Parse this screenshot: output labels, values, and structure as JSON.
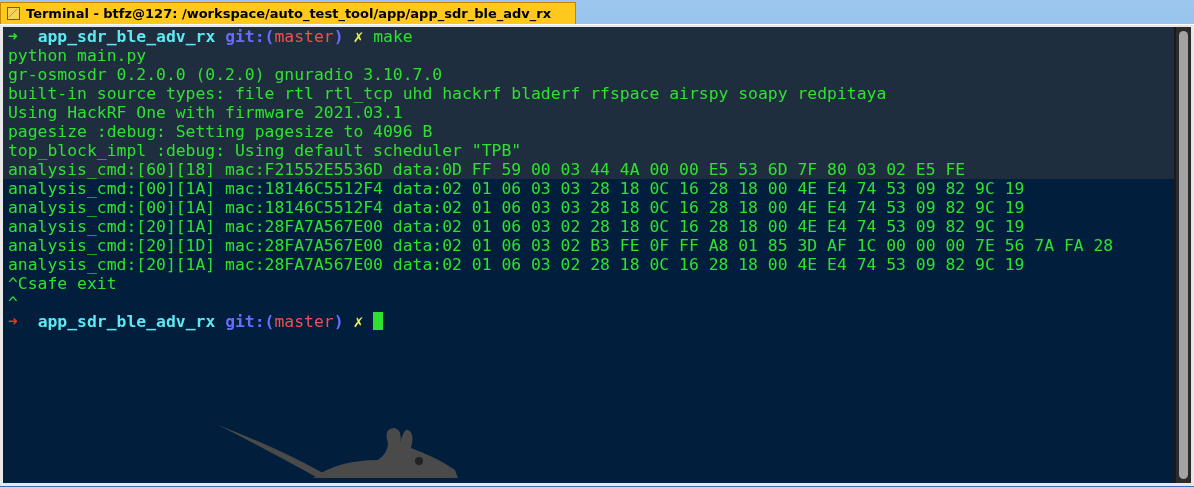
{
  "window": {
    "title": "Terminal - btfz@127: /workspace/auto_test_tool/app/app_sdr_ble_adv_rx"
  },
  "lines": [
    {
      "kind": "prompt",
      "failed": false,
      "arrow": "➜",
      "directory": "app_sdr_ble_adv_rx",
      "git_open": "git:(",
      "branch": "master",
      "git_close": ")",
      "dirty": "✗",
      "command": "make",
      "cursor": false
    },
    {
      "kind": "output",
      "text": "python main.py"
    },
    {
      "kind": "output",
      "text": "gr-osmosdr 0.2.0.0 (0.2.0) gnuradio 3.10.7.0"
    },
    {
      "kind": "output",
      "text": "built-in source types: file rtl rtl_tcp uhd hackrf bladerf rfspace airspy soapy redpitaya"
    },
    {
      "kind": "output",
      "text": "Using HackRF One with firmware 2021.03.1"
    },
    {
      "kind": "output",
      "text": "pagesize :debug: Setting pagesize to 4096 B"
    },
    {
      "kind": "output",
      "text": "top_block_impl :debug: Using default scheduler \"TPB\""
    },
    {
      "kind": "output",
      "text": "analysis_cmd:[60][18] mac:F21552E5536D data:0D FF 59 00 03 44 4A 00 00 E5 53 6D 7F 80 03 02 E5 FE"
    },
    {
      "kind": "output",
      "text": "analysis_cmd:[00][1A] mac:18146C5512F4 data:02 01 06 03 03 28 18 0C 16 28 18 00 4E E4 74 53 09 82 9C 19"
    },
    {
      "kind": "output",
      "text": "analysis_cmd:[00][1A] mac:18146C5512F4 data:02 01 06 03 03 28 18 0C 16 28 18 00 4E E4 74 53 09 82 9C 19"
    },
    {
      "kind": "output",
      "text": "analysis_cmd:[20][1A] mac:28FA7A567E00 data:02 01 06 03 02 28 18 0C 16 28 18 00 4E E4 74 53 09 82 9C 19"
    },
    {
      "kind": "output",
      "text": "analysis_cmd:[20][1D] mac:28FA7A567E00 data:02 01 06 03 02 B3 FE 0F FF A8 01 85 3D AF 1C 00 00 00 7E 56 7A FA 28"
    },
    {
      "kind": "output",
      "text": "analysis_cmd:[20][1A] mac:28FA7A567E00 data:02 01 06 03 02 28 18 0C 16 28 18 00 4E E4 74 53 09 82 9C 19"
    },
    {
      "kind": "output",
      "text": "^Csafe exit"
    },
    {
      "kind": "output",
      "text": "^"
    },
    {
      "kind": "prompt",
      "failed": true,
      "arrow": "➜",
      "directory": "app_sdr_ble_adv_rx",
      "git_open": "git:(",
      "branch": "master",
      "git_close": ")",
      "dirty": "✗",
      "cursor": true
    }
  ]
}
